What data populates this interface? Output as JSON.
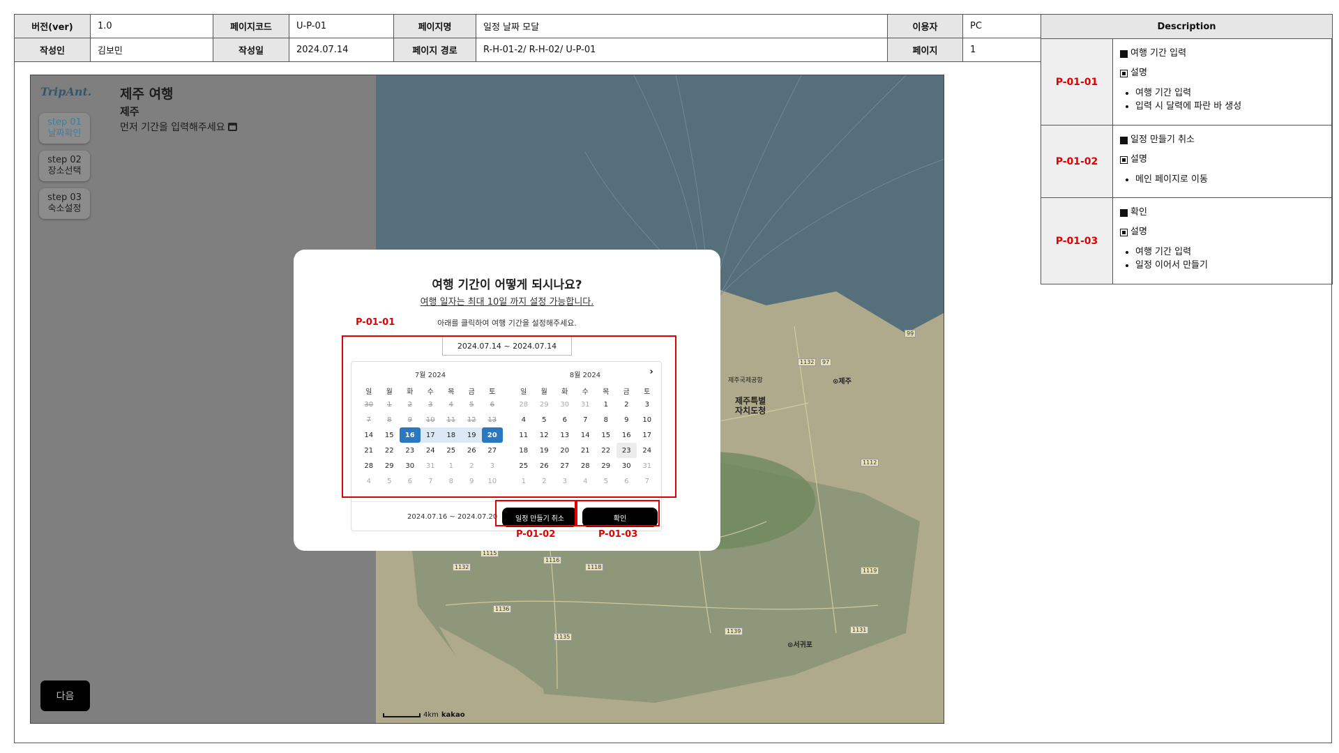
{
  "meta": {
    "version_label": "버전(ver)",
    "version": "1.0",
    "page_code_label": "페이지코드",
    "page_code": "U-P-01",
    "page_name_label": "페이지명",
    "page_name": "일정 날짜 모달",
    "user_label": "이용자",
    "user": "PC",
    "author_label": "작성인",
    "author": "김보민",
    "date_label": "작성일",
    "date": "2024.07.14",
    "path_label": "페이지 경로",
    "path": "R-H-01-2/ R-H-02/ U-P-01",
    "page_label": "페이지",
    "page": "1"
  },
  "description": {
    "header": "Description",
    "items": [
      {
        "id": "P-01-01",
        "title": "여행 기간 입력",
        "sub": "설명",
        "bullets": [
          "여행 기간 입력",
          "입력 시 달력에 파란 바 생성"
        ]
      },
      {
        "id": "P-01-02",
        "title": "일정 만들기 취소",
        "sub": "설명",
        "bullets": [
          "메인 페이지로 이동"
        ]
      },
      {
        "id": "P-01-03",
        "title": "확인",
        "sub": "설명",
        "bullets": [
          "여행 기간 입력",
          "일정 이어서 만들기"
        ]
      }
    ]
  },
  "app": {
    "logo": "TripAnt.",
    "trip_title": "제주 여행",
    "trip_region": "제주",
    "trip_hint": "먼저 기간을 입력해주세요",
    "steps": [
      {
        "line1": "step 01",
        "line2": "날짜확인",
        "active": true
      },
      {
        "line1": "step 02",
        "line2": "장소선택",
        "active": false
      },
      {
        "line1": "step 03",
        "line2": "숙소설정",
        "active": false
      }
    ],
    "next_label": "다음",
    "map_labels": {
      "jeju": "⊙제주",
      "jeju_special": "제주특별",
      "jeju_special2": "자치도청",
      "airport": "제주국제공항",
      "seogwipo": "⊙서귀포",
      "scale": "4km",
      "brand": "kakao",
      "roads": [
        "1132",
        "97",
        "99",
        "1112",
        "1115",
        "1116",
        "1118",
        "1119",
        "1131",
        "1132",
        "1135",
        "1136",
        "1139"
      ]
    }
  },
  "modal": {
    "title": "여행 기간이 어떻게 되시나요?",
    "subtitle": "여행 일자는 최대 10일 까지 설정 가능합니다.",
    "instruction": "아래를 클릭하여 여행 기간을 설정해주세요.",
    "range_value": "2024.07.14 ~ 2024.07.14",
    "weekdays": [
      "일",
      "월",
      "화",
      "수",
      "목",
      "금",
      "토"
    ],
    "months": [
      {
        "title": "7월 2024",
        "weeks": [
          [
            "30",
            "1",
            "2",
            "3",
            "4",
            "5",
            "6"
          ],
          [
            "7",
            "8",
            "9",
            "10",
            "11",
            "12",
            "13"
          ],
          [
            "14",
            "15",
            "16",
            "17",
            "18",
            "19",
            "20"
          ],
          [
            "21",
            "22",
            "23",
            "24",
            "25",
            "26",
            "27"
          ],
          [
            "28",
            "29",
            "30",
            "31",
            "1",
            "2",
            "3"
          ],
          [
            "4",
            "5",
            "6",
            "7",
            "8",
            "9",
            "10"
          ]
        ],
        "disabled_cells": 14,
        "selected": [
          "16",
          "20"
        ],
        "in_range": [
          "17",
          "18",
          "19"
        ],
        "trailing_from": 32
      },
      {
        "title": "8월 2024",
        "weeks": [
          [
            "28",
            "29",
            "30",
            "31",
            "1",
            "2",
            "3"
          ],
          [
            "4",
            "5",
            "6",
            "7",
            "8",
            "9",
            "10"
          ],
          [
            "11",
            "12",
            "13",
            "14",
            "15",
            "16",
            "17"
          ],
          [
            "18",
            "19",
            "20",
            "21",
            "22",
            "23",
            "24"
          ],
          [
            "25",
            "26",
            "27",
            "28",
            "29",
            "30",
            "31"
          ],
          [
            "1",
            "2",
            "3",
            "4",
            "5",
            "6",
            "7"
          ]
        ],
        "leading_other": 4,
        "trailing_from": 35,
        "hover": "23"
      }
    ],
    "selected_range": "2024.07.16 ~ 2024.07.20",
    "cancel_label": "일정 만들기 취소",
    "confirm_label": "확인"
  },
  "annotations": {
    "p1": "P-01-01",
    "p2": "P-01-02",
    "p3": "P-01-03"
  },
  "colors": {
    "accent": "#2b78c2",
    "range": "#dbe9f7",
    "annotation": "#e00000"
  }
}
